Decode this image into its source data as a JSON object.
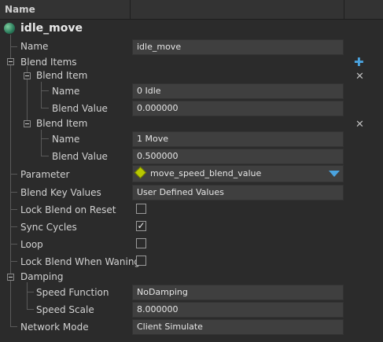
{
  "header": {
    "title": "Name"
  },
  "root": {
    "title": "idle_move"
  },
  "rows": {
    "name": {
      "label": "Name",
      "value": "idle_move"
    },
    "blend_items": {
      "label": "Blend Items"
    },
    "blend_item_1": {
      "label": "Blend Item",
      "name_label": "Name",
      "name_value": "0 Idle",
      "value_label": "Blend Value",
      "value_value": "0.000000"
    },
    "blend_item_2": {
      "label": "Blend Item",
      "name_label": "Name",
      "name_value": "1 Move",
      "value_label": "Blend Value",
      "value_value": "0.500000"
    },
    "parameter": {
      "label": "Parameter",
      "value": "move_speed_blend_value"
    },
    "blend_key_values": {
      "label": "Blend Key Values",
      "value": "User Defined Values"
    },
    "lock_blend_on_reset": {
      "label": "Lock Blend on Reset",
      "checked": false
    },
    "sync_cycles": {
      "label": "Sync Cycles",
      "checked": true,
      "mark": "✓"
    },
    "loop": {
      "label": "Loop",
      "checked": false
    },
    "lock_blend_when_waning": {
      "label": "Lock Blend When Waning",
      "checked": false
    },
    "damping": {
      "label": "Damping"
    },
    "speed_function": {
      "label": "Speed Function",
      "value": "NoDamping"
    },
    "speed_scale": {
      "label": "Speed Scale",
      "value": "8.000000"
    },
    "network_mode": {
      "label": "Network Mode",
      "value": "Client Simulate"
    }
  },
  "icons": {
    "add": "plus-icon",
    "remove": "close-icon",
    "root": "sphere-icon",
    "param": "diamond-icon",
    "dropdown": "triangle-down-icon"
  },
  "colors": {
    "add_icon": "#4aa3df",
    "param_icon": "#b8c800",
    "dropdown": "#4aa3df"
  }
}
